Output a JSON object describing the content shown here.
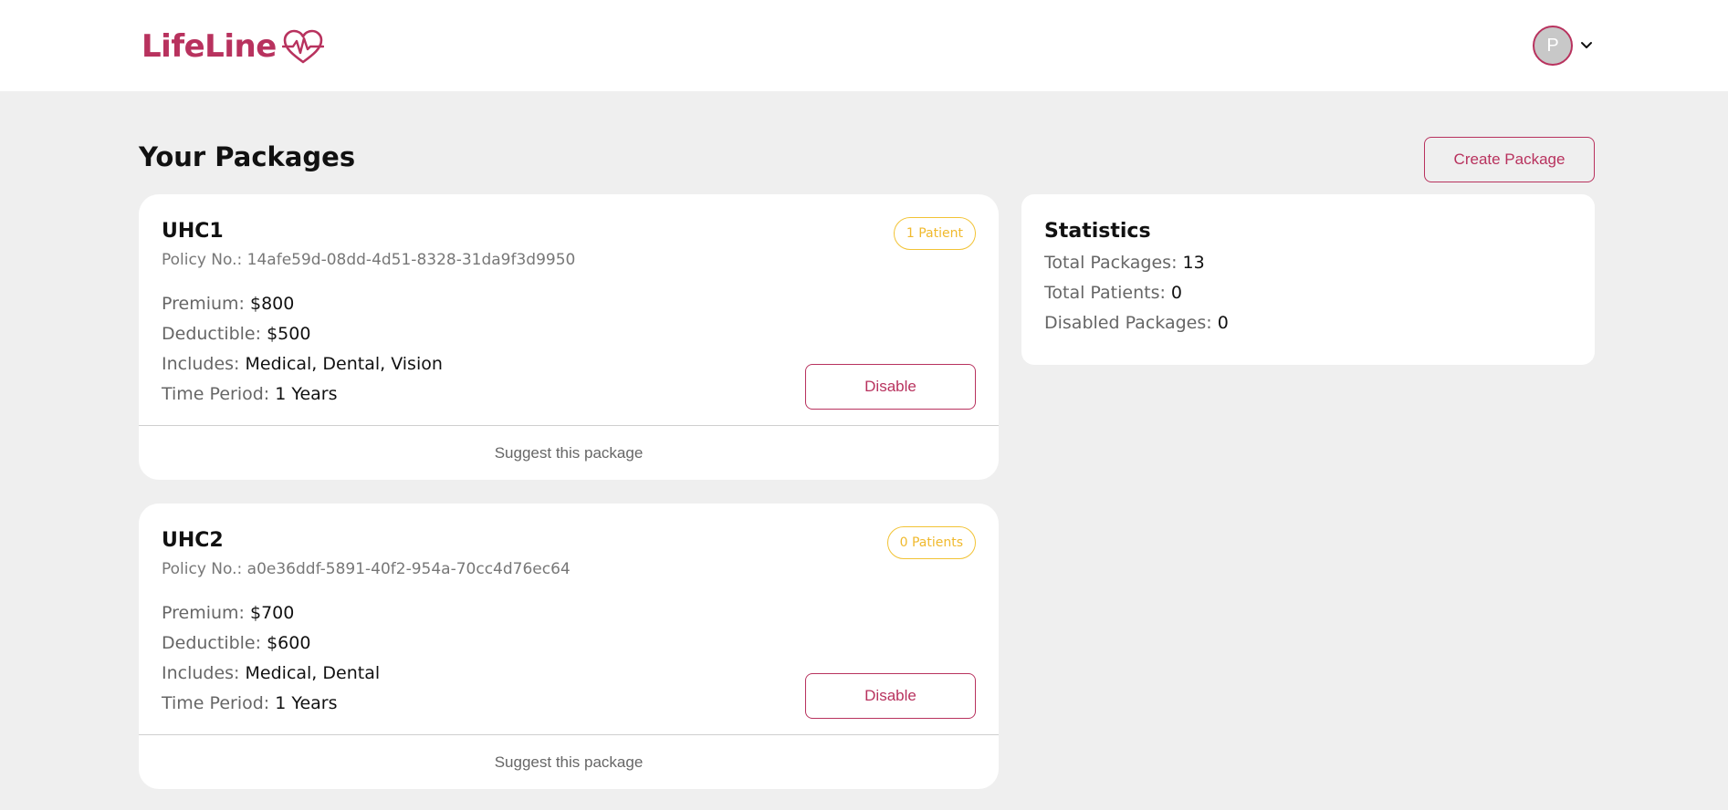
{
  "header": {
    "logo_text": "LifeLine",
    "avatar_initial": "P",
    "brand_color": "#b8325e"
  },
  "main": {
    "title": "Your Packages",
    "create_button": "Create Package"
  },
  "packages": [
    {
      "name": "UHC1",
      "policy_label": "Policy No.:",
      "policy_no": "14afe59d-08dd-4d51-8328-31da9f3d9950",
      "badge": "1 Patient",
      "premium_label": "Premium:",
      "premium": "$800",
      "deductible_label": "Deductible:",
      "deductible": "$500",
      "includes_label": "Includes:",
      "includes": "Medical, Dental, Vision",
      "period_label": "Time Period:",
      "period": "1 Years",
      "disable_label": "Disable",
      "footer_label": "Suggest this package"
    },
    {
      "name": "UHC2",
      "policy_label": "Policy No.:",
      "policy_no": "a0e36ddf-5891-40f2-954a-70cc4d76ec64",
      "badge": "0 Patients",
      "premium_label": "Premium:",
      "premium": "$700",
      "deductible_label": "Deductible:",
      "deductible": "$600",
      "includes_label": "Includes:",
      "includes": "Medical, Dental",
      "period_label": "Time Period:",
      "period": "1 Years",
      "disable_label": "Disable",
      "footer_label": "Suggest this package"
    }
  ],
  "statistics": {
    "title": "Statistics",
    "total_packages_label": "Total Packages:",
    "total_packages": "13",
    "total_patients_label": "Total Patients:",
    "total_patients": "0",
    "disabled_packages_label": "Disabled Packages:",
    "disabled_packages": "0"
  },
  "icons": [
    "heart-pulse-icon",
    "chevron-down-icon"
  ]
}
